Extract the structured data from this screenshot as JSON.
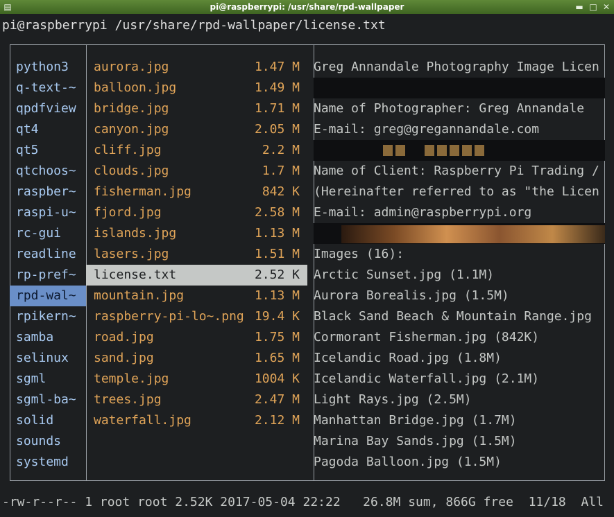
{
  "window": {
    "title": "pi@raspberrypi: /usr/share/rpd-wallpaper"
  },
  "terminal": {
    "path": "pi@raspberrypi /usr/share/rpd-wallpaper/license.txt"
  },
  "parent_dir": [
    {
      "name": "python3"
    },
    {
      "name": "q-text-~"
    },
    {
      "name": "qpdfview"
    },
    {
      "name": "qt4"
    },
    {
      "name": "qt5"
    },
    {
      "name": "qtchoos~"
    },
    {
      "name": "raspber~"
    },
    {
      "name": "raspi-u~"
    },
    {
      "name": "rc-gui"
    },
    {
      "name": "readline"
    },
    {
      "name": "rp-pref~"
    },
    {
      "name": "rpd-wal~",
      "selected": true
    },
    {
      "name": "rpikern~"
    },
    {
      "name": "samba"
    },
    {
      "name": "selinux"
    },
    {
      "name": "sgml"
    },
    {
      "name": "sgml-ba~"
    },
    {
      "name": "solid"
    },
    {
      "name": "sounds"
    },
    {
      "name": "systemd"
    }
  ],
  "files": [
    {
      "name": "aurora.jpg",
      "size": "1.47 M"
    },
    {
      "name": "balloon.jpg",
      "size": "1.49 M"
    },
    {
      "name": "bridge.jpg",
      "size": "1.71 M"
    },
    {
      "name": "canyon.jpg",
      "size": "2.05 M"
    },
    {
      "name": "cliff.jpg",
      "size": "2.2 M"
    },
    {
      "name": "clouds.jpg",
      "size": "1.7 M"
    },
    {
      "name": "fisherman.jpg",
      "size": "842 K"
    },
    {
      "name": "fjord.jpg",
      "size": "2.58 M"
    },
    {
      "name": "islands.jpg",
      "size": "1.13 M"
    },
    {
      "name": "lasers.jpg",
      "size": "1.51 M"
    },
    {
      "name": "license.txt",
      "size": "2.52 K",
      "selected": true
    },
    {
      "name": "mountain.jpg",
      "size": "1.13 M"
    },
    {
      "name": "raspberry-pi-lo~.png",
      "size": "19.4 K"
    },
    {
      "name": "road.jpg",
      "size": "1.75 M"
    },
    {
      "name": "sand.jpg",
      "size": "1.65 M"
    },
    {
      "name": "temple.jpg",
      "size": "1004 K"
    },
    {
      "name": "trees.jpg",
      "size": "2.47 M"
    },
    {
      "name": "waterfall.jpg",
      "size": "2.12 M"
    }
  ],
  "preview": [
    {
      "text": "Greg Annandale Photography Image Licen"
    },
    {
      "text": "",
      "image": "dark"
    },
    {
      "text": "Name of Photographer: Greg Annandale"
    },
    {
      "text": "E-mail: greg@gregannandale.com"
    },
    {
      "text": "",
      "image": "windows"
    },
    {
      "text": "Name of Client: Raspberry Pi Trading /"
    },
    {
      "text": "(Hereinafter referred to as \"the Licen"
    },
    {
      "text": "E-mail: admin@raspberrypi.org"
    },
    {
      "text": "",
      "image": "lights"
    },
    {
      "text": "Images (16):"
    },
    {
      "text": "Arctic Sunset.jpg (1.1M)"
    },
    {
      "text": "Aurora Borealis.jpg (1.5M)"
    },
    {
      "text": "Black Sand Beach & Mountain Range.jpg"
    },
    {
      "text": "Cormorant Fisherman.jpg (842K)"
    },
    {
      "text": "Icelandic Road.jpg (1.8M)"
    },
    {
      "text": "Icelandic Waterfall.jpg (2.1M)"
    },
    {
      "text": "Light Rays.jpg (2.5M)"
    },
    {
      "text": "Manhattan Bridge.jpg (1.7M)"
    },
    {
      "text": "Marina Bay Sands.jpg (1.5M)"
    },
    {
      "text": "Pagoda Balloon.jpg (1.5M)"
    }
  ],
  "status": {
    "text": "-rw-r--r-- 1 root root 2.52K 2017-05-04 22:22   26.8M sum, 866G free  11/18  All"
  },
  "colors": {
    "titlebar": "#4f7a2c",
    "dir": "#a8c9f0",
    "file": "#e0a458",
    "selected_dir": "#6a8fc8",
    "selected_file": "#c5c8c6"
  },
  "icons": {
    "menu": "terminal-menu-icon",
    "minimize": "minimize-icon",
    "maximize": "maximize-icon",
    "close": "close-icon"
  }
}
